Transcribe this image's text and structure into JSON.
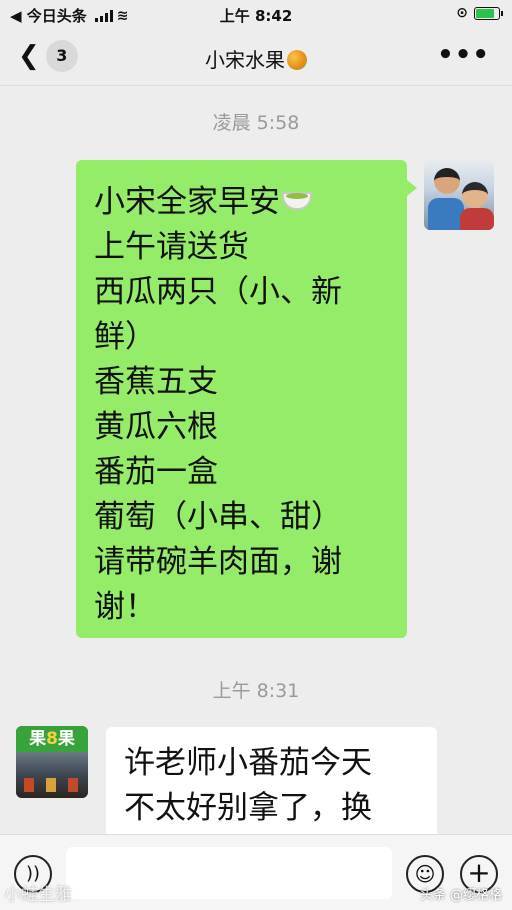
{
  "status_bar": {
    "back_app": "◀ 今日头条",
    "time": "上午 8:42",
    "battery_level": 0.8
  },
  "nav": {
    "unread_count": "3",
    "title": "小宋水果",
    "more": "•••"
  },
  "messages": [
    {
      "timestamp": "凌晨 5:58",
      "side": "right",
      "lines": [
        "小宋全家早安",
        "上午请送货",
        "西瓜两只（小、新",
        "鲜）",
        "香蕉五支",
        "黄瓜六根",
        "番茄一盒",
        "葡萄（小串、甜）",
        "请带碗羊肉面，谢",
        "谢！"
      ]
    },
    {
      "timestamp": "上午 8:31",
      "side": "left",
      "avatar_sign": [
        "果",
        "8",
        "果"
      ],
      "lines": [
        "许老师小番茄今天",
        "不太好别拿了，换"
      ]
    }
  ],
  "input_bar": {
    "voice_icon": "voice-icon",
    "emoji_icon": "emoji-icon",
    "plus_icon": "plus-icon"
  },
  "watermarks": {
    "left": "小蛙生雅",
    "right": "头条 @缨格格"
  }
}
